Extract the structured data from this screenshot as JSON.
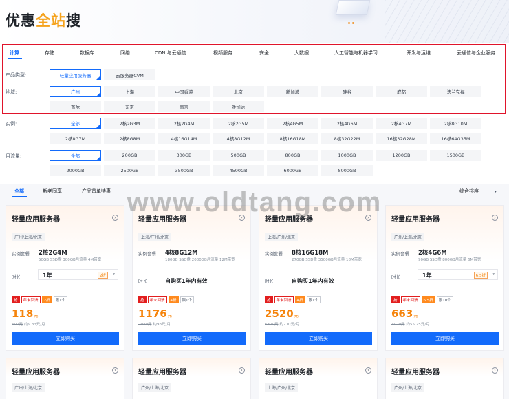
{
  "hero": {
    "title_a": "优惠",
    "title_b": "全站",
    "title_c": "搜"
  },
  "categories": [
    "计算",
    "存储",
    "数据库",
    "网络",
    "CDN 与云通信",
    "视频服务",
    "安全",
    "大数据",
    "人工智能与机器学习",
    "开发与运维",
    "云通信与企业服务"
  ],
  "labels": {
    "product_type": "产品类型:",
    "region": "地域:",
    "instance": "实例:",
    "traffic": "月流量:"
  },
  "product_types": [
    "轻量应用服务器",
    "云服务器CVM"
  ],
  "regions": [
    "广州",
    "上海",
    "中国香港",
    "北京",
    "新加坡",
    "硅谷",
    "成都",
    "法兰克福",
    "首尔",
    "东京",
    "南京",
    "雅加达"
  ],
  "instances": [
    "全部",
    "2核2G3M",
    "2核2G4M",
    "2核2G5M",
    "2核4G5M",
    "2核4G6M",
    "2核4G7M",
    "2核8G10M",
    "2核8G7M",
    "2核8G8M",
    "4核16G14M",
    "4核8G12M",
    "8核16G18M",
    "8核32G22M",
    "16核32G28M",
    "16核64G35M"
  ],
  "traffic": [
    "全部",
    "200GB",
    "300GB",
    "500GB",
    "800GB",
    "1000GB",
    "1200GB",
    "1500GB",
    "2000GB",
    "2500GB",
    "3500GB",
    "4500GB",
    "6000GB",
    "8000GB"
  ],
  "sub_tabs": [
    "全部",
    "新老同享",
    "产品首单特惠"
  ],
  "sort": {
    "label": "综合排序",
    "caret": "▾"
  },
  "watermark": "www.oldtang.com",
  "common": {
    "spec_label": "实例套餐",
    "duration_label": "时长",
    "buy_label": "立即购买",
    "arrow": "›",
    "caret": "▾",
    "tag_hot": "抢",
    "tag_event": "年末回馈",
    "currency": "元"
  },
  "cards": [
    {
      "title": "轻量应用服务器",
      "region": "广州/上海/北京",
      "spec": "2核2G4M",
      "desc": "50GB SSD盘 300GB月流量 4M带宽",
      "duration": "1年",
      "duration_discount": "2折",
      "duration_is_select": true,
      "discount": "2折",
      "limit": "限1个",
      "price": "118",
      "orig_price": "600元",
      "monthly": "约9.83元/月"
    },
    {
      "title": "轻量应用服务器",
      "region": "上海/广州/北京",
      "spec": "4核8G12M",
      "desc": "180GB SSD盘 2000GB月流量 12M带宽",
      "duration": "自购买1年内有效",
      "duration_discount": "",
      "duration_is_select": false,
      "discount": "4折",
      "limit": "限1个",
      "price": "1176",
      "orig_price": "2940元",
      "monthly": "约98元/月"
    },
    {
      "title": "轻量应用服务器",
      "region": "上海/广州/北京",
      "spec": "8核16G18M",
      "desc": "270GB SSD盘 3500GB月流量 18M带宽",
      "duration": "自购买1年内有效",
      "duration_discount": "",
      "duration_is_select": false,
      "discount": "4折",
      "limit": "限1个",
      "price": "2520",
      "orig_price": "6300元",
      "monthly": "约210元/月"
    },
    {
      "title": "轻量应用服务器",
      "region": "广州/上海/北京",
      "spec": "2核4G6M",
      "desc": "90GB SSD盘 800GB月流量 6M带宽",
      "duration": "1年",
      "duration_discount": "6.5折",
      "duration_is_select": true,
      "discount": "6.5折",
      "limit": "限10个",
      "price": "663",
      "orig_price": "1020元",
      "monthly": "约55.25元/月"
    }
  ],
  "bottom_cards": [
    {
      "title": "轻量应用服务器",
      "region": "广州/上海/北京"
    },
    {
      "title": "轻量应用服务器",
      "region": "广州/上海/北京"
    },
    {
      "title": "轻量应用服务器",
      "region": "上海/广州/北京"
    },
    {
      "title": "轻量应用服务器",
      "region": "广州/上海/北京"
    }
  ],
  "colors": {
    "accent": "#136bfb",
    "price": "#f5840c",
    "highlight_box": "#e0142b",
    "tag_red": "#e21e1e"
  }
}
